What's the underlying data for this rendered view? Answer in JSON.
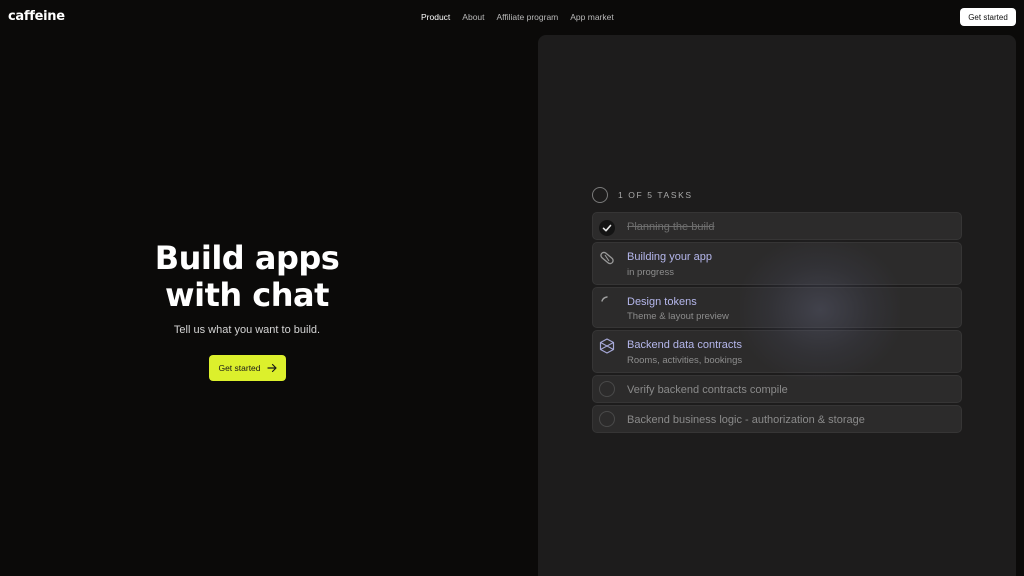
{
  "header": {
    "logo": "caffeine",
    "nav": [
      "Product",
      "About",
      "Affiliate program",
      "App market"
    ],
    "cta": "Get started"
  },
  "hero": {
    "title_line1": "Build apps",
    "title_line2": "with chat",
    "subtitle": "Tell us what you want to build.",
    "cta": "Get started"
  },
  "tasks": {
    "progress_label": "1 OF 5 TASKS",
    "items": [
      {
        "title": "Planning the build",
        "subtitle": "",
        "state": "done",
        "icon": "check-icon"
      },
      {
        "title": "Building your app",
        "subtitle": "in progress",
        "state": "active",
        "icon": "pill-icon"
      },
      {
        "title": "Design tokens",
        "subtitle": "Theme & layout preview",
        "state": "active",
        "icon": "spinner-icon"
      },
      {
        "title": "Backend data contracts",
        "subtitle": "Rooms, activities, bookings",
        "state": "active",
        "icon": "box-icon"
      },
      {
        "title": "Verify backend contracts compile",
        "subtitle": "",
        "state": "pending",
        "icon": "empty-circle-icon"
      },
      {
        "title": "Backend business logic - authorization & storage",
        "subtitle": "",
        "state": "pending",
        "icon": "empty-circle-icon"
      }
    ]
  },
  "colors": {
    "background": "#0b0a09",
    "panel": "#1d1c1c",
    "accent": "#dcf02c",
    "active_task": "#b5b7ec"
  }
}
